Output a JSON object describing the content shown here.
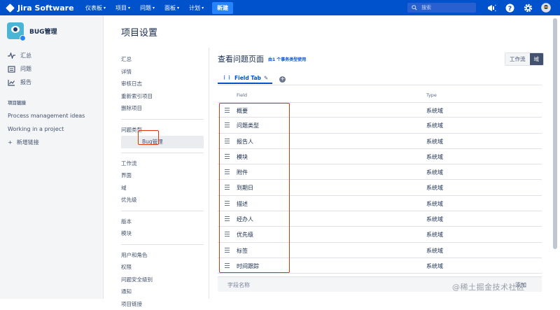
{
  "topbar": {
    "product": "Jira Software",
    "nav": [
      {
        "label": "仪表板",
        "dropdown": true
      },
      {
        "label": "项目",
        "dropdown": true
      },
      {
        "label": "问题",
        "dropdown": true
      },
      {
        "label": "面板",
        "dropdown": true
      },
      {
        "label": "计划",
        "dropdown": true
      }
    ],
    "create_label": "新建",
    "search_placeholder": "搜索",
    "accent": "#0052cc"
  },
  "sidebar": {
    "project_name": "BUG管理",
    "items": [
      {
        "label": "汇总",
        "icon": "pulse-icon"
      },
      {
        "label": "问题",
        "icon": "issues-icon"
      },
      {
        "label": "报告",
        "icon": "chart-icon"
      }
    ],
    "links_heading": "项目链接",
    "links": [
      "Process management ideas",
      "Working in a project"
    ],
    "add_link": "新增链接"
  },
  "page": {
    "title": "项目设置"
  },
  "settings_nav": {
    "group1": [
      "汇总",
      "详情",
      "审核日志",
      "重新索引项目",
      "删除项目"
    ],
    "issue_types_label": "问题类型",
    "issue_type_selected": "Bug管理",
    "group2": [
      "工作流",
      "界面",
      "域",
      "优先级"
    ],
    "group3": [
      "版本",
      "模块"
    ],
    "group4": [
      "用户和角色",
      "权限",
      "问题安全级别",
      "通知",
      "项目链接"
    ]
  },
  "main": {
    "title": "查看问题页面",
    "tag": "由1 个事务类型使用",
    "toggle": {
      "workflow": "工作流",
      "field": "域"
    },
    "tab_label": "Field Tab",
    "columns": {
      "field": "Field",
      "type": "Type"
    },
    "fields": [
      {
        "name": "概要",
        "type": "系统域"
      },
      {
        "name": "问题类型",
        "type": "系统域"
      },
      {
        "name": "报告人",
        "type": "系统域"
      },
      {
        "name": "模块",
        "type": "系统域"
      },
      {
        "name": "附件",
        "type": "系统域"
      },
      {
        "name": "到期日",
        "type": "系统域"
      },
      {
        "name": "描述",
        "type": "系统域"
      },
      {
        "name": "经办人",
        "type": "系统域"
      },
      {
        "name": "优先级",
        "type": "系统域"
      },
      {
        "name": "标签",
        "type": "系统域"
      },
      {
        "name": "时间跟踪",
        "type": "系统域"
      }
    ],
    "add_field_placeholder": "字段名称",
    "add_button": "添加"
  },
  "watermark": "@稀土掘金技术社区",
  "highlight_color": "#de350b"
}
